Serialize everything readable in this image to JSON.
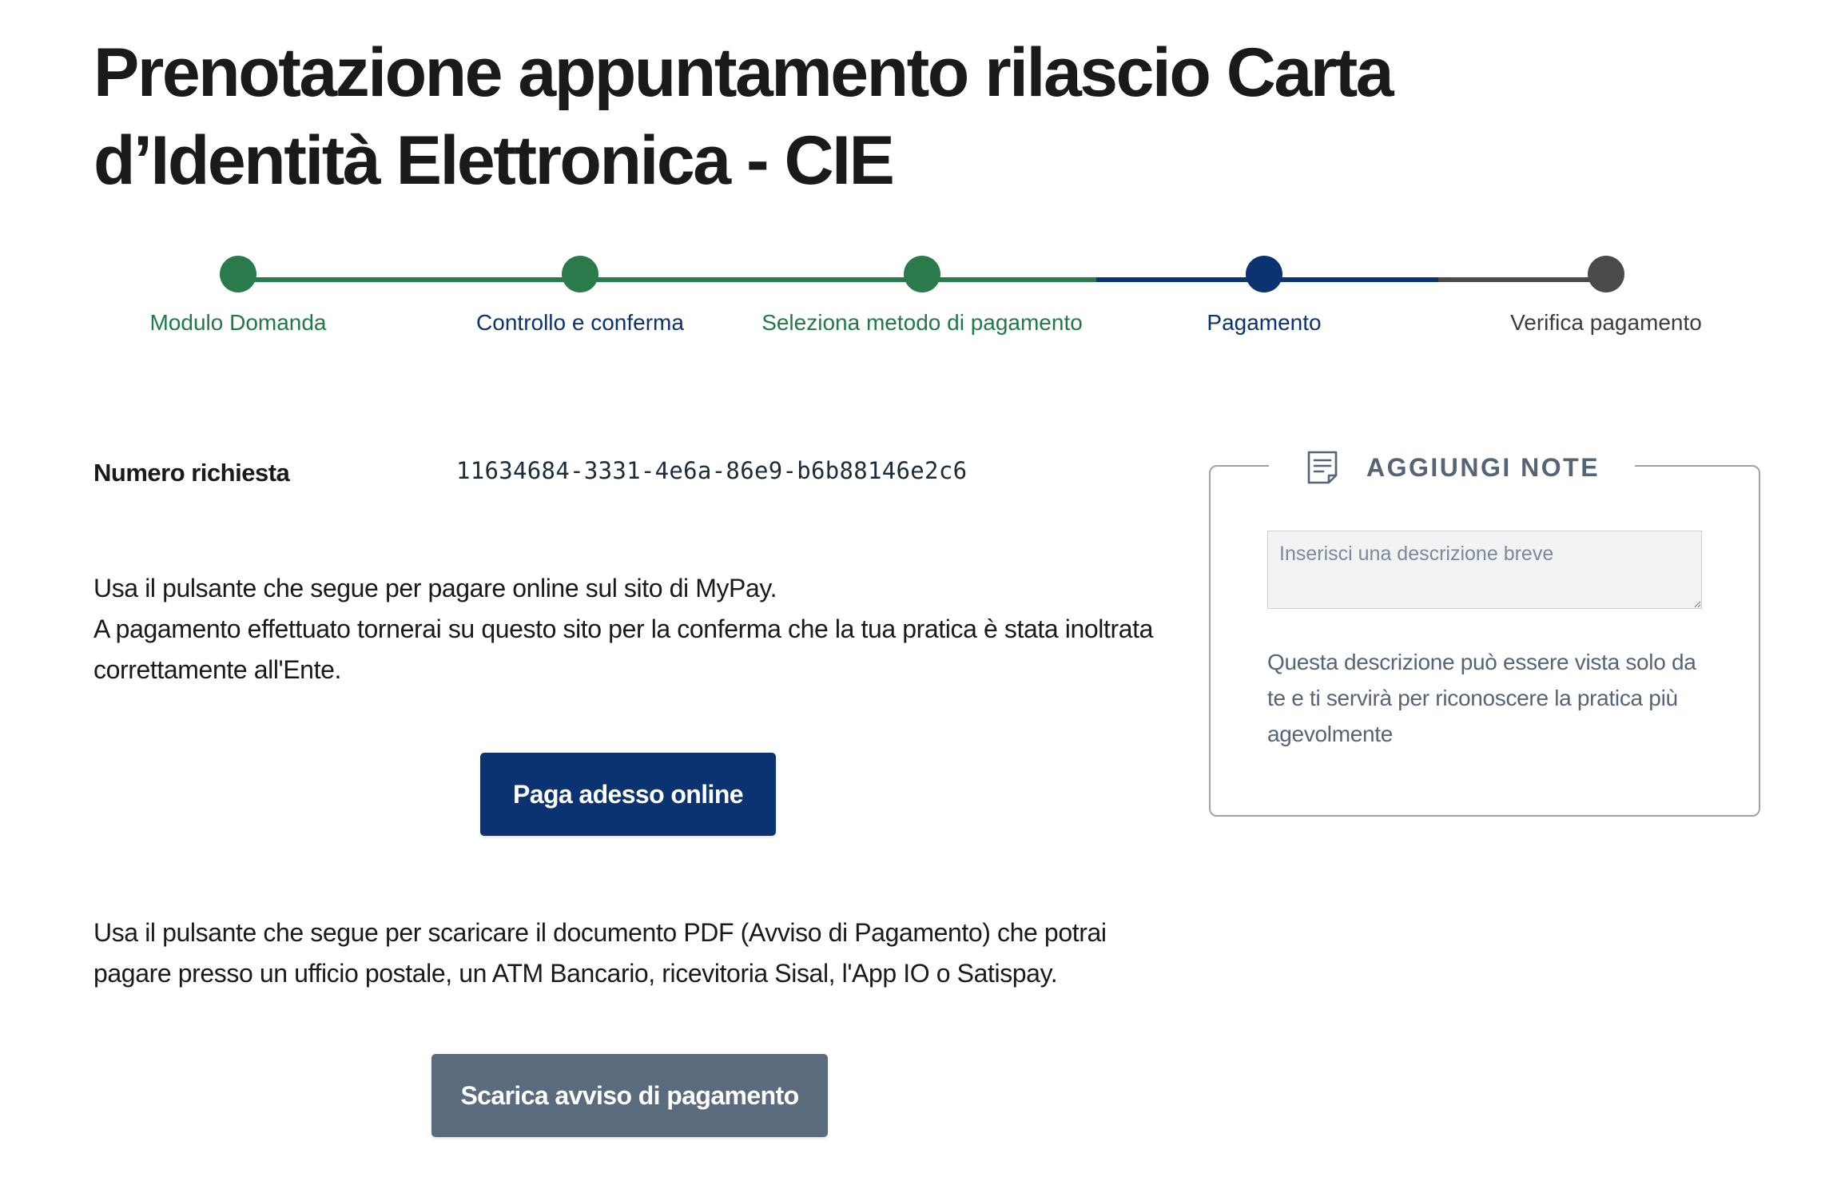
{
  "page": {
    "title": "Prenotazione appuntamento rilascio Carta d’Identità Elettronica - CIE"
  },
  "stepper": {
    "steps": [
      {
        "label": "Modulo Domanda",
        "status": "completed",
        "dot_color": "#2b7a4b",
        "label_color": "#1f7a46"
      },
      {
        "label": "Controllo e conferma",
        "status": "completed",
        "dot_color": "#2b7a4b",
        "label_color": "#0b3271"
      },
      {
        "label": "Seleziona metodo di pagamento",
        "status": "completed",
        "dot_color": "#2b7a4b",
        "label_color": "#1f7a46"
      },
      {
        "label": "Pagamento",
        "status": "current",
        "dot_color": "#0b3271",
        "label_color": "#0b3271"
      },
      {
        "label": "Verifica pagamento",
        "status": "upcoming",
        "dot_color": "#4a4a4a",
        "label_color": "#3d3d3d"
      }
    ],
    "colors": {
      "completed": "#2b7a4b",
      "current": "#0b3271",
      "upcoming": "#4a4a4a"
    }
  },
  "request": {
    "label": "Numero richiesta",
    "value": "11634684-3331-4e6a-86e9-b6b88146e2c6"
  },
  "payment_online": {
    "text_line1": "Usa il pulsante che segue per pagare online sul sito di MyPay.",
    "text_line2": "A pagamento effettuato tornerai su questo sito per la conferma che la tua pratica è stata inoltrata correttamente all'Ente.",
    "button_label": "Paga adesso online"
  },
  "payment_notice": {
    "text": "Usa il pulsante che segue per scaricare il documento PDF (Avviso di Pagamento) che potrai pagare presso un ufficio postale, un ATM Bancario, ricevitoria Sisal, l'App IO o Satispay.",
    "button_label": "Scarica avviso di pagamento"
  },
  "notes": {
    "title": "AGGIUNGI NOTE",
    "icon": "note-icon",
    "placeholder": "Inserisci una descrizione breve",
    "value": "",
    "help": "Questa descrizione può essere vista solo da te e ti servirà per riconoscere la pratica più agevolmente"
  },
  "colors": {
    "primary": "#0b3271",
    "secondary_button": "#5b6b7e",
    "success": "#2b7a4b",
    "muted": "#556477"
  }
}
